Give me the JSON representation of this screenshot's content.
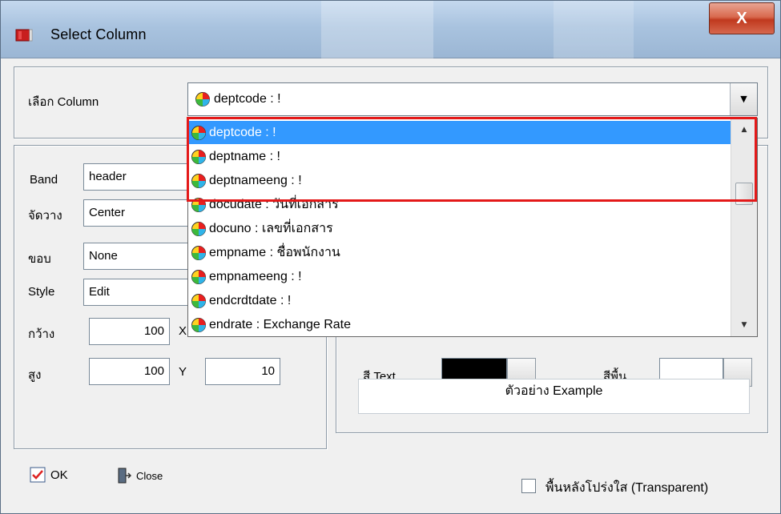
{
  "window": {
    "title": "Select Column",
    "close_label": "X"
  },
  "select_column": {
    "label": "เลือก Column",
    "value": "deptcode : !"
  },
  "dropdown": {
    "items": [
      {
        "text": "deptcode : !",
        "selected": true
      },
      {
        "text": "deptname : !",
        "selected": false
      },
      {
        "text": "deptnameeng : !",
        "selected": false
      },
      {
        "text": "docudate : วันที่เอกสาร",
        "selected": false
      },
      {
        "text": "docuno : เลขที่เอกสาร",
        "selected": false
      },
      {
        "text": "empname : ชื่อพนักงาน",
        "selected": false
      },
      {
        "text": "empnameeng : !",
        "selected": false
      },
      {
        "text": "endcrdtdate : !",
        "selected": false
      },
      {
        "text": "endrate : Exchange Rate",
        "selected": false
      }
    ]
  },
  "form": {
    "band_label": "Band",
    "band_value": "header",
    "align_label": "จัดวาง",
    "align_value": "Center",
    "border_label": "ขอบ",
    "border_value": "None",
    "style_label": "Style",
    "style_value": "Edit",
    "width_label": "กว้าง",
    "width_value": "100",
    "height_label": "สูง",
    "height_value": "100",
    "x_label": "X",
    "y_label": "Y",
    "y_value": "10"
  },
  "colors": {
    "text_color_label": "สี Text",
    "text_color": "#000000",
    "bg_color_label": "สีพื้น",
    "bg_color": "#ffffff",
    "selection": "#3399ff",
    "highlight_border": "#e41919"
  },
  "preview": {
    "example_text": "ตัวอย่าง Example"
  },
  "buttons": {
    "ok_label": "OK",
    "close_label": "Close"
  },
  "transparent": {
    "label": "พื้นหลังโปร่งใส (Transparent)",
    "checked": false
  }
}
